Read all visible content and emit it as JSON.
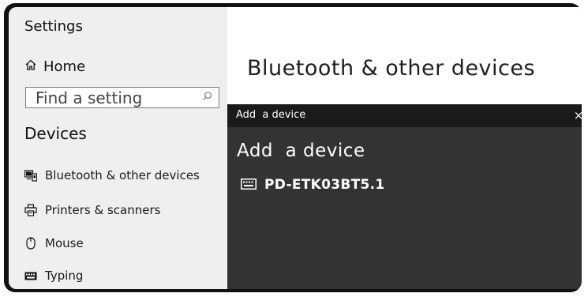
{
  "sidebar": {
    "title": "Settings",
    "home_label": "Home",
    "search": {
      "placeholder": "Find a setting",
      "value": ""
    },
    "section_heading": "Devices",
    "items": [
      {
        "label": "Bluetooth & other devices",
        "icon": "bluetooth-devices-icon"
      },
      {
        "label": "Printers & scanners",
        "icon": "printer-icon"
      },
      {
        "label": "Mouse",
        "icon": "mouse-icon"
      },
      {
        "label": "Typing",
        "icon": "keyboard-icon"
      }
    ]
  },
  "main": {
    "title": "Bluetooth & other devices"
  },
  "dialog": {
    "titlebar": "Add  a device",
    "close_symbol": "×",
    "heading": "Add  a device",
    "devices": [
      {
        "name": "PD-ETK03BT5.1",
        "icon": "keyboard-icon"
      }
    ]
  },
  "colors": {
    "sidebar_bg": "#efefef",
    "dialog_bg": "#333333",
    "dialog_titlebar_bg": "#1a1a1a",
    "frame": "#111111"
  }
}
